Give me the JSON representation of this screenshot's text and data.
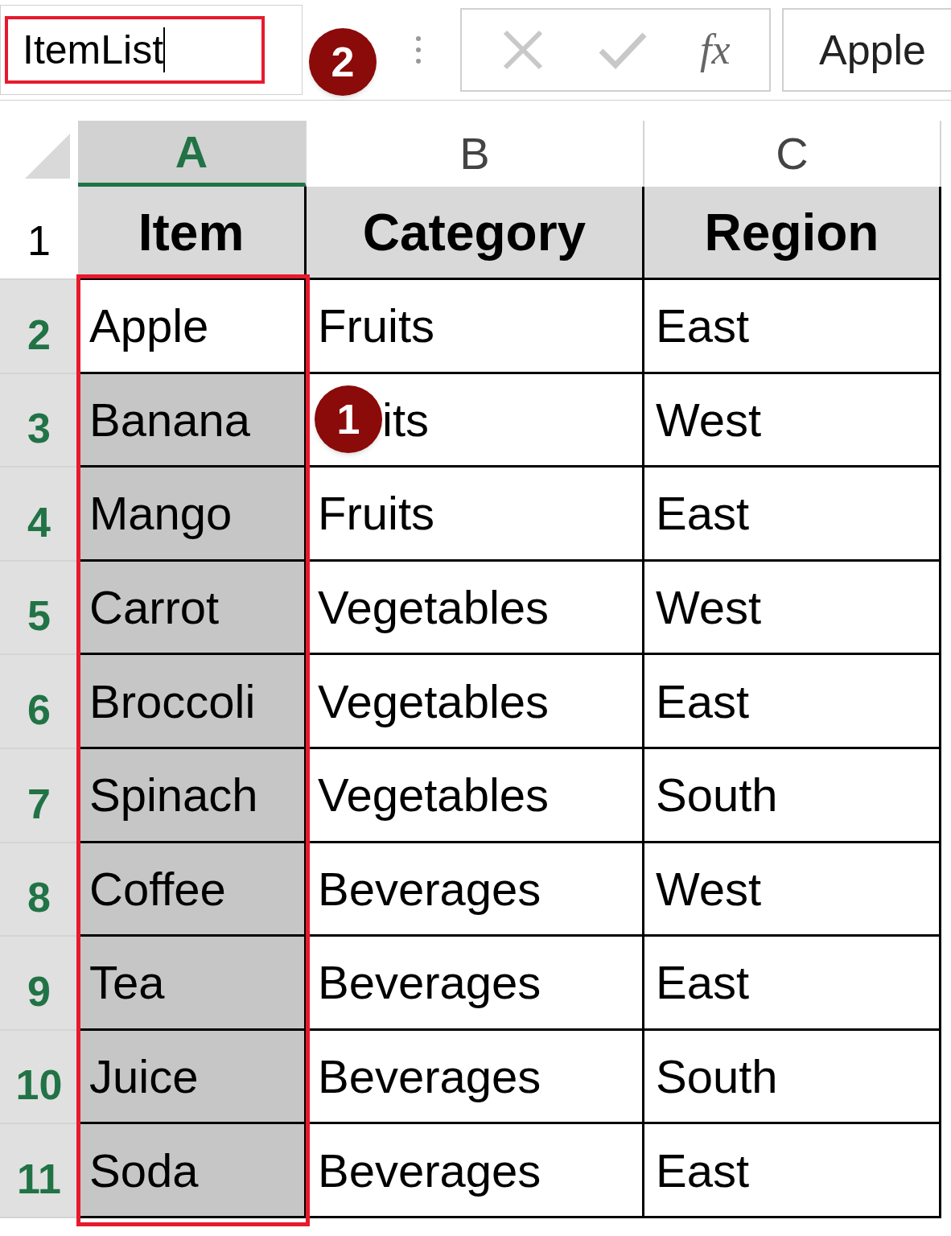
{
  "name_box": {
    "value": "ItemList",
    "badge": "2"
  },
  "formula_bar": {
    "fx": "fx",
    "value": "Apple"
  },
  "columns": [
    {
      "label": "A",
      "selected": true
    },
    {
      "label": "B",
      "selected": false
    },
    {
      "label": "C",
      "selected": false
    }
  ],
  "rows": [
    {
      "number": "1",
      "selected": false,
      "kind": "header",
      "cells": [
        {
          "text": "Item"
        },
        {
          "text": "Category"
        },
        {
          "text": "Region"
        }
      ]
    },
    {
      "number": "2",
      "selected": true,
      "kind": "data",
      "cells": [
        {
          "text": "Apple",
          "selected": false
        },
        {
          "text": "Fruits",
          "selected": false
        },
        {
          "text": "East",
          "selected": false
        }
      ]
    },
    {
      "number": "3",
      "selected": true,
      "kind": "data",
      "cells": [
        {
          "text": "Banana",
          "selected": true
        },
        {
          "text": "its",
          "badge": "1",
          "selected": false
        },
        {
          "text": "West",
          "selected": false
        }
      ]
    },
    {
      "number": "4",
      "selected": true,
      "kind": "data",
      "cells": [
        {
          "text": "Mango",
          "selected": true
        },
        {
          "text": "Fruits",
          "selected": false
        },
        {
          "text": "East",
          "selected": false
        }
      ]
    },
    {
      "number": "5",
      "selected": true,
      "kind": "data",
      "cells": [
        {
          "text": "Carrot",
          "selected": true
        },
        {
          "text": "Vegetables",
          "selected": false
        },
        {
          "text": "West",
          "selected": false
        }
      ]
    },
    {
      "number": "6",
      "selected": true,
      "kind": "data",
      "cells": [
        {
          "text": "Broccoli",
          "selected": true
        },
        {
          "text": "Vegetables",
          "selected": false
        },
        {
          "text": "East",
          "selected": false
        }
      ]
    },
    {
      "number": "7",
      "selected": true,
      "kind": "data",
      "cells": [
        {
          "text": "Spinach",
          "selected": true
        },
        {
          "text": "Vegetables",
          "selected": false
        },
        {
          "text": "South",
          "selected": false
        }
      ]
    },
    {
      "number": "8",
      "selected": true,
      "kind": "data",
      "cells": [
        {
          "text": "Coffee",
          "selected": true
        },
        {
          "text": "Beverages",
          "selected": false
        },
        {
          "text": "West",
          "selected": false
        }
      ]
    },
    {
      "number": "9",
      "selected": true,
      "kind": "data",
      "cells": [
        {
          "text": "Tea",
          "selected": true
        },
        {
          "text": "Beverages",
          "selected": false
        },
        {
          "text": "East",
          "selected": false
        }
      ]
    },
    {
      "number": "10",
      "selected": true,
      "kind": "data",
      "cells": [
        {
          "text": "Juice",
          "selected": true
        },
        {
          "text": "Beverages",
          "selected": false
        },
        {
          "text": "South",
          "selected": false
        }
      ]
    },
    {
      "number": "11",
      "selected": true,
      "kind": "data",
      "cells": [
        {
          "text": "Soda",
          "selected": true
        },
        {
          "text": "Beverages",
          "selected": false
        },
        {
          "text": "East",
          "selected": false
        }
      ]
    }
  ]
}
